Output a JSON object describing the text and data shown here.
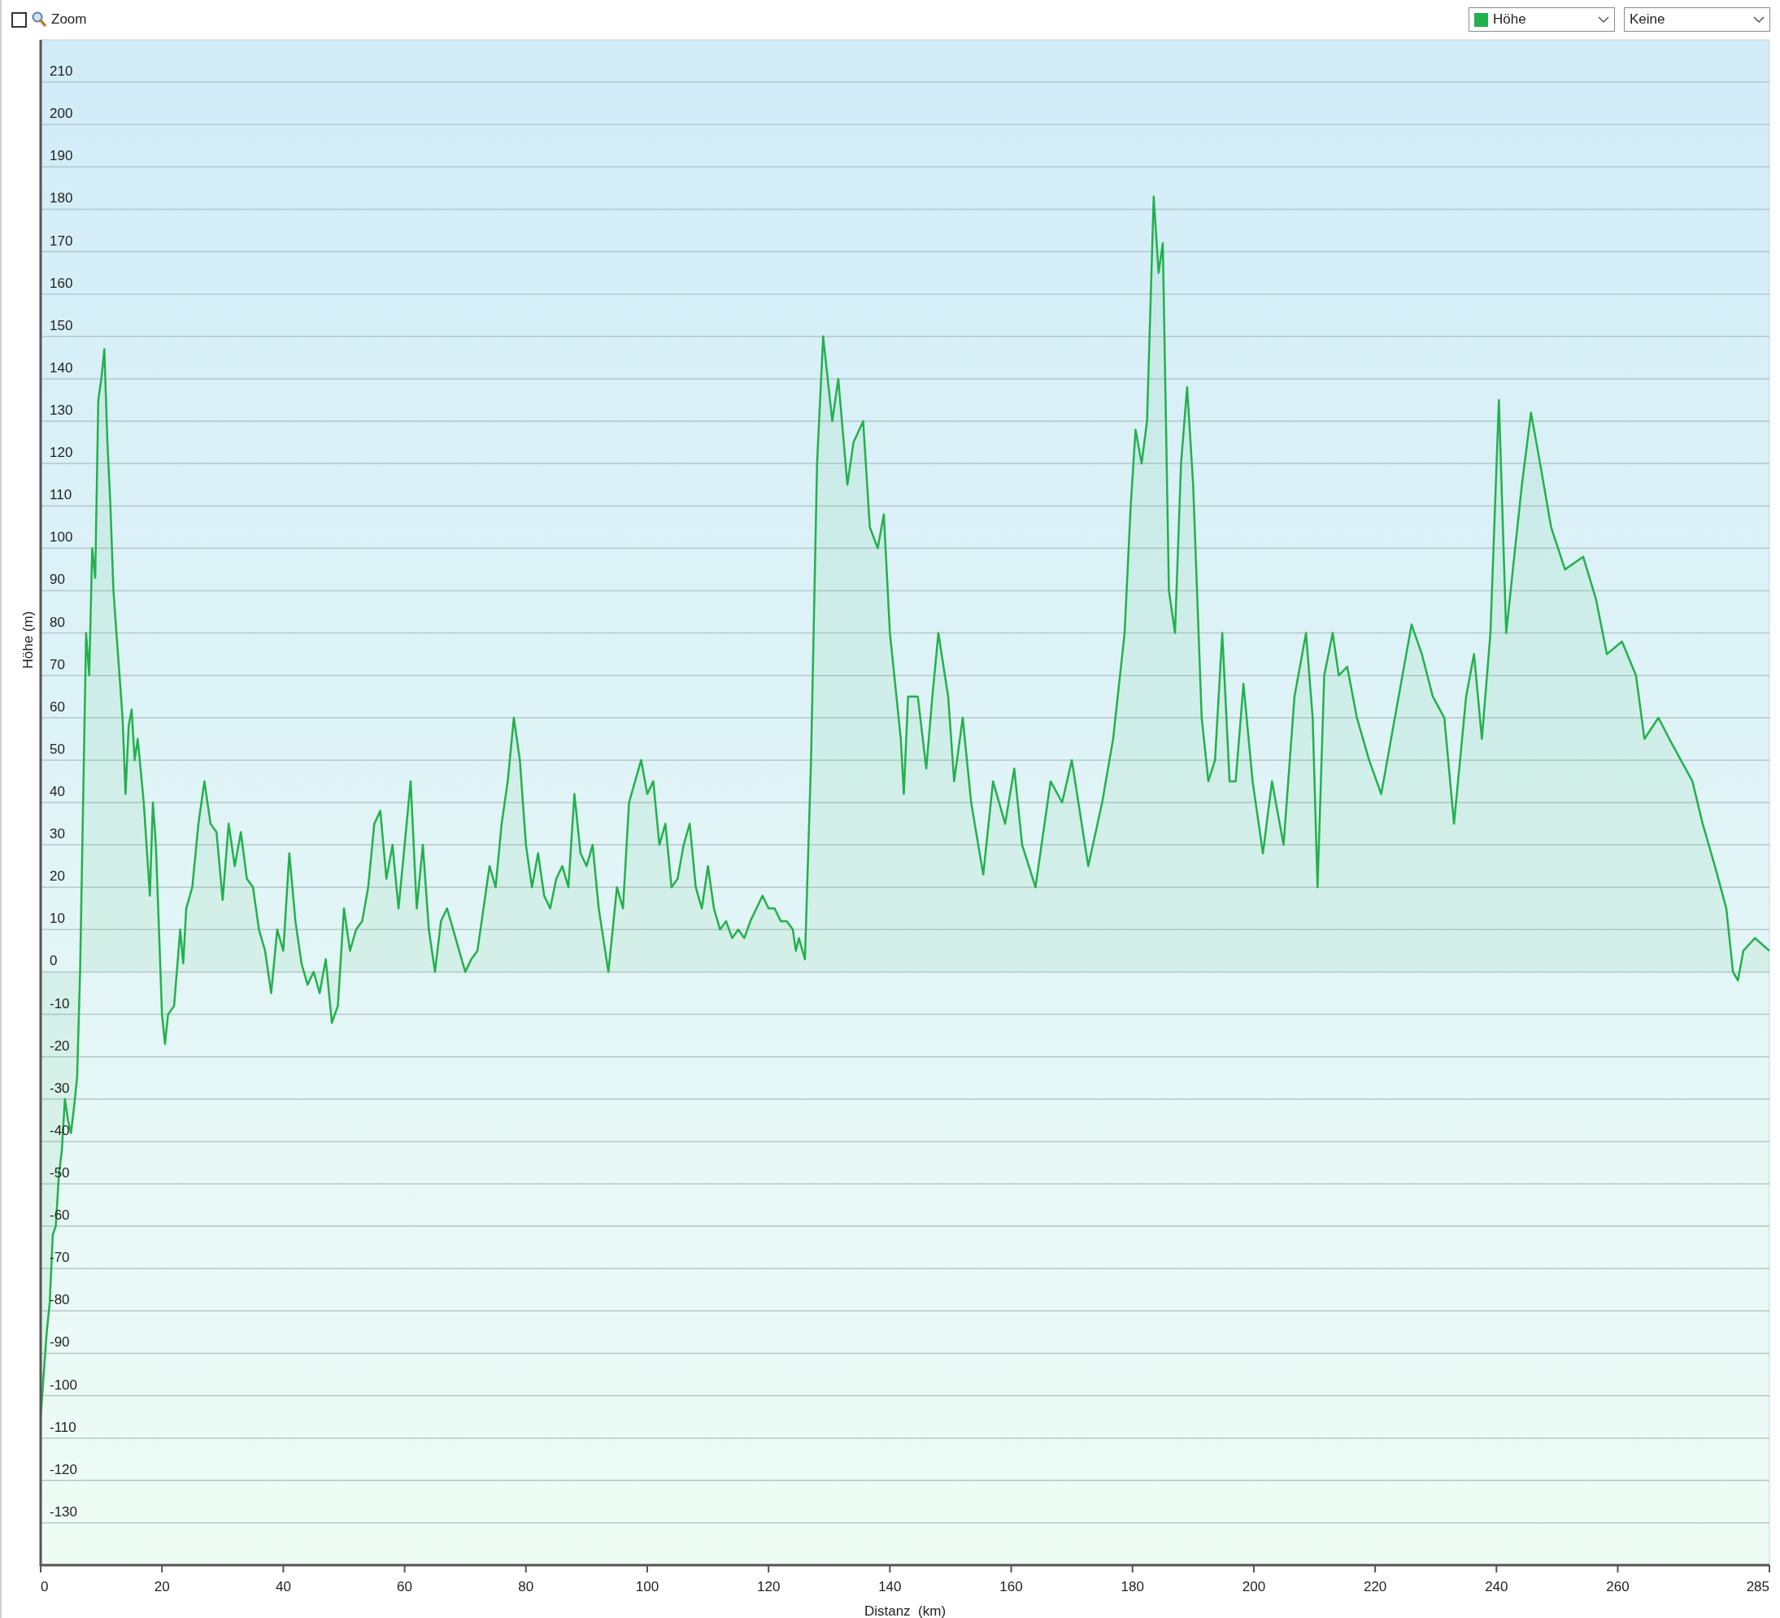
{
  "toolbar": {
    "zoom": {
      "label": "Zoom",
      "checked": false
    },
    "compare_select": {
      "value": "Keine"
    }
  },
  "chart": {
    "chart_data": {
      "type": "area",
      "grid": true,
      "xlabel": "Distanz  (km)",
      "ylabel": "Höhe (m)",
      "xlim": [
        0,
        285
      ],
      "ylim": [
        -140,
        220
      ],
      "xticks": [
        0,
        20,
        40,
        60,
        80,
        100,
        120,
        140,
        160,
        180,
        200,
        220,
        240,
        260,
        285
      ],
      "yticks": [
        -130,
        -120,
        -110,
        -100,
        -90,
        -80,
        -70,
        -60,
        -50,
        -40,
        -30,
        -20,
        -10,
        0,
        10,
        20,
        30,
        40,
        50,
        60,
        70,
        80,
        90,
        100,
        110,
        120,
        130,
        140,
        150,
        160,
        170,
        180,
        190,
        200,
        210
      ],
      "x": [
        0,
        0.5,
        1,
        1.5,
        2,
        2.5,
        3,
        3.5,
        4,
        4.5,
        5,
        5.5,
        6,
        6.5,
        7,
        7.5,
        8,
        8.5,
        9,
        9.5,
        10,
        10.5,
        11,
        11.5,
        12,
        12.5,
        13,
        13.5,
        14,
        14.5,
        15,
        15.5,
        16,
        17,
        18,
        18.5,
        19,
        19.5,
        20,
        20.5,
        21,
        22,
        23,
        23.5,
        24,
        25,
        26,
        27,
        28,
        29,
        30,
        31,
        32,
        33,
        34,
        35,
        36,
        37,
        38,
        39,
        40,
        41,
        42,
        43,
        44,
        45,
        46,
        47,
        48,
        49,
        50,
        51,
        52,
        53,
        54,
        55,
        56,
        57,
        58,
        59,
        60,
        61,
        62,
        63,
        64,
        65,
        66,
        67,
        68,
        69,
        70,
        71,
        72,
        73,
        74,
        75,
        76,
        77,
        78,
        79,
        80,
        81,
        82,
        83,
        84,
        85,
        86,
        87,
        88,
        89,
        90,
        91,
        92,
        93.6,
        95,
        96,
        97,
        98,
        99,
        100,
        101,
        102,
        103,
        104,
        105,
        106,
        107,
        108,
        109,
        110,
        111,
        112,
        113,
        114,
        115,
        116,
        117,
        118,
        119,
        120,
        121,
        122,
        123,
        124,
        124.5,
        125,
        126,
        127,
        128,
        129,
        130.5,
        131.5,
        133,
        134,
        135.6,
        136.7,
        138,
        139,
        140,
        141.8,
        142.3,
        143,
        144.6,
        146,
        147,
        148,
        149.6,
        150.6,
        152,
        153.4,
        155.4,
        157,
        159,
        160.5,
        161.8,
        164,
        166.5,
        168.4,
        170,
        172.7,
        175,
        176.8,
        178.7,
        179.7,
        180.5,
        181.5,
        182.4,
        183.5,
        184.3,
        185,
        186,
        187,
        188,
        189,
        190,
        191.4,
        192.5,
        193.6,
        194.8,
        196,
        197,
        198.3,
        199.8,
        201.5,
        203,
        204.9,
        206.7,
        208.6,
        209.7,
        210.5,
        211.6,
        213,
        214,
        215.4,
        217,
        219,
        221,
        223,
        226,
        227.7,
        229.5,
        231.4,
        233,
        235,
        236.3,
        237.6,
        239,
        240.4,
        241.6,
        242.7,
        244.2,
        245.7,
        247.2,
        249,
        251.3,
        254.3,
        256.4,
        258.2,
        260.7,
        263,
        264.4,
        266.7,
        268.5,
        270.4,
        272.3,
        274,
        276,
        277.9,
        279,
        279.8,
        280.7,
        282.6,
        285
      ],
      "series": [
        {
          "name": "Höhe",
          "color": "#22b14c",
          "values": [
            -105,
            -95,
            -85,
            -78,
            -62,
            -60,
            -48,
            -42,
            -30,
            -35,
            -38,
            -32,
            -25,
            0,
            40,
            80,
            70,
            100,
            93,
            135,
            140,
            147,
            125,
            110,
            90,
            80,
            70,
            60,
            42,
            58,
            62,
            50,
            55,
            40,
            18,
            40,
            30,
            10,
            -10,
            -17,
            -10,
            -8,
            10,
            2,
            15,
            20,
            35,
            45,
            35,
            33,
            17,
            35,
            25,
            33,
            22,
            20,
            10,
            5,
            -5,
            10,
            5,
            28,
            12,
            2,
            -3,
            0,
            -5,
            3,
            -12,
            -8,
            15,
            5,
            10,
            12,
            20,
            35,
            38,
            22,
            30,
            15,
            30,
            45,
            15,
            30,
            10,
            0,
            12,
            15,
            10,
            5,
            0,
            3,
            5,
            15,
            25,
            20,
            35,
            45,
            60,
            50,
            30,
            20,
            28,
            18,
            15,
            22,
            25,
            20,
            42,
            28,
            25,
            30,
            15,
            0,
            20,
            15,
            40,
            45,
            50,
            42,
            45,
            30,
            35,
            20,
            22,
            30,
            35,
            20,
            15,
            25,
            15,
            10,
            12,
            8,
            10,
            8,
            12,
            15,
            18,
            15,
            15,
            12,
            12,
            10,
            5,
            8,
            3,
            50,
            120,
            150,
            130,
            140,
            115,
            125,
            130,
            105,
            100,
            108,
            80,
            55,
            42,
            65,
            65,
            48,
            65,
            80,
            65,
            45,
            60,
            40,
            23,
            45,
            35,
            48,
            30,
            20,
            45,
            40,
            50,
            25,
            40,
            55,
            80,
            110,
            128,
            120,
            130,
            183,
            165,
            172,
            90,
            80,
            120,
            138,
            115,
            60,
            45,
            50,
            80,
            45,
            45,
            68,
            45,
            28,
            45,
            30,
            65,
            80,
            60,
            20,
            70,
            80,
            70,
            72,
            60,
            50,
            42,
            58,
            82,
            75,
            65,
            60,
            35,
            65,
            75,
            55,
            80,
            135,
            80,
            95,
            115,
            132,
            120,
            105,
            95,
            98,
            88,
            75,
            78,
            70,
            55,
            60,
            55,
            50,
            45,
            35,
            25,
            15,
            0,
            -2,
            5,
            8,
            5
          ]
        }
      ]
    }
  }
}
